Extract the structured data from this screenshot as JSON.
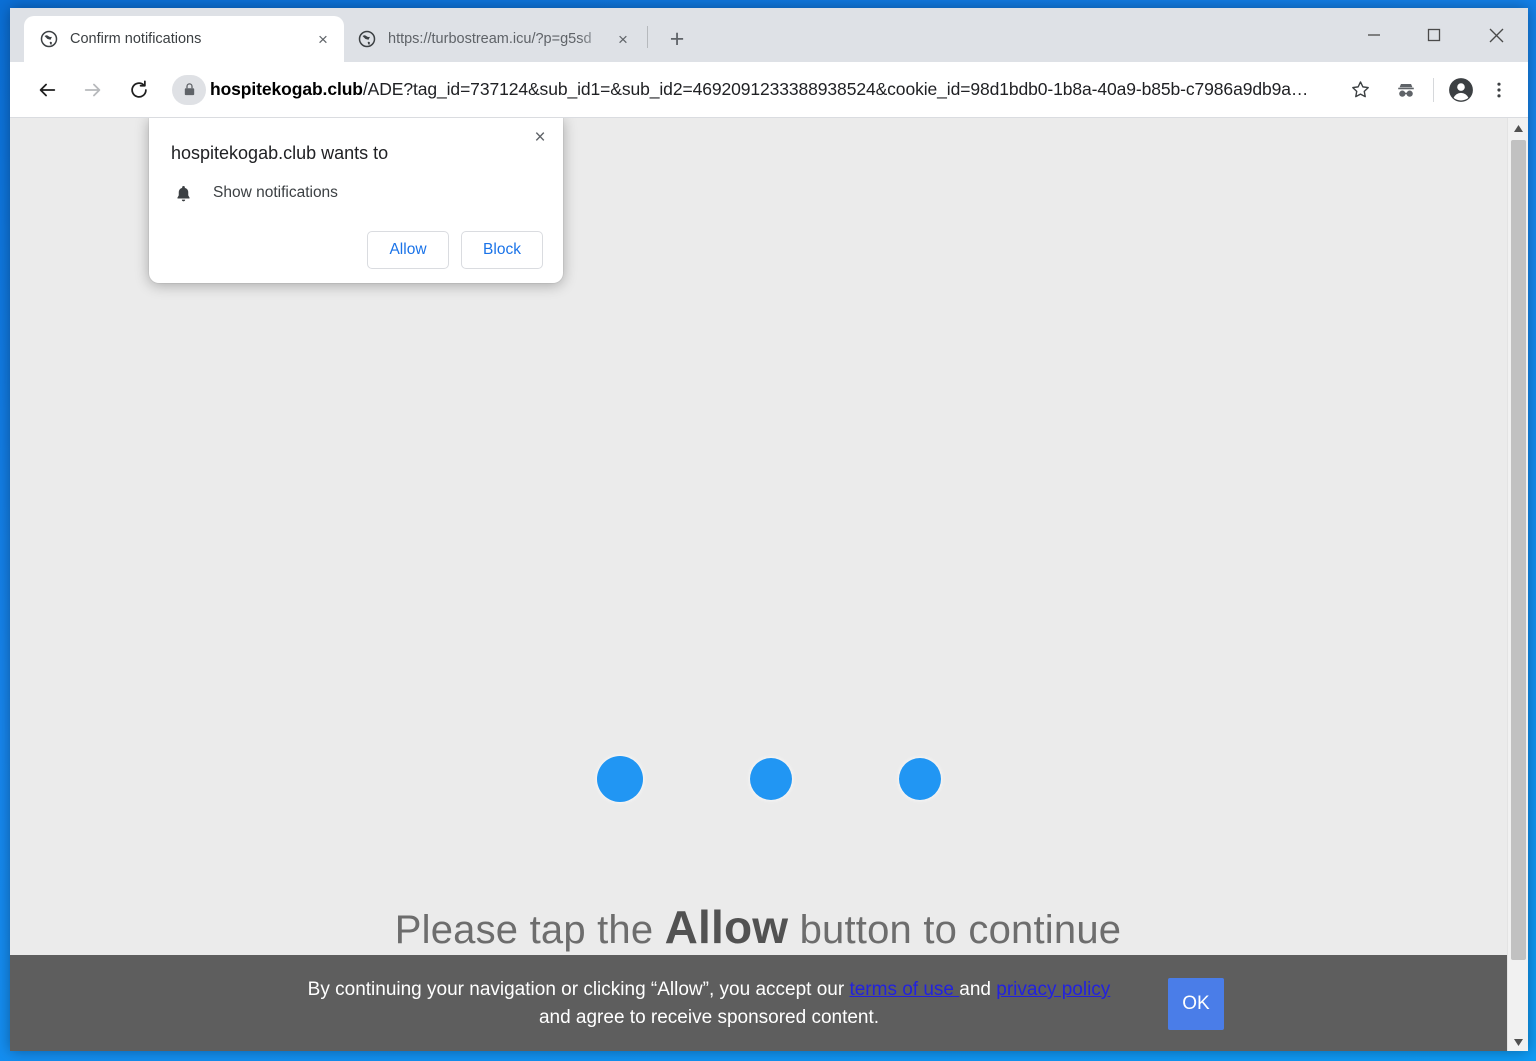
{
  "window": {
    "controls": [
      {
        "name": "minimize",
        "glyph": "minimize-icon"
      },
      {
        "name": "maximize",
        "glyph": "maximize-icon"
      },
      {
        "name": "close",
        "glyph": "close-icon"
      }
    ]
  },
  "tabs": [
    {
      "title": "Confirm notifications",
      "active": true,
      "favicon": "globe-icon",
      "close_label": "×"
    },
    {
      "title": "https://turbostream.icu/?p=g5sd",
      "active": false,
      "favicon": "globe-icon",
      "close_label": "×"
    }
  ],
  "new_tab_label": "+",
  "toolbar": {
    "back_icon": "back-arrow-icon",
    "forward_icon": "forward-arrow-icon",
    "reload_icon": "reload-icon",
    "lock_icon": "lock-icon",
    "url_host": "hospitekogab.club",
    "url_path": "/ADE?tag_id=737124&sub_id1=&sub_id2=4692091233388938524&cookie_id=98d1bdb0-1b8a-40a9-b85b-c7986a9db9a…",
    "url_full": "hospitekogab.club/ADE?tag_id=737124&sub_id1=&sub_id2=4692091233388938524&cookie_id=98d1bdb0-1b8a-40a9-b85b-c7986a9db9a…",
    "bookmark_icon": "star-icon",
    "extension_icon": "incognito-extension-icon",
    "profile_icon": "profile-avatar-icon",
    "menu_icon": "three-dot-menu-icon"
  },
  "permission_dialog": {
    "title": "hospitekogab.club wants to",
    "option_icon": "bell-icon",
    "option_label": "Show notifications",
    "allow_label": "Allow",
    "block_label": "Block",
    "close_label": "×"
  },
  "page": {
    "background_color": "#ebebeb",
    "dots_color": "#2196f3",
    "dots_count": 3,
    "headline_prefix": "Please tap the ",
    "headline_strong": "Allow",
    "headline_suffix": " button to continue"
  },
  "consent_bar": {
    "background_color": "#5e5e5e",
    "text_before": "By continuing your navigation or clicking “Allow”, you accept our ",
    "link_terms": "terms of use ",
    "text_between": "and ",
    "link_privacy": "privacy policy",
    "text_after": " and agree to receive sponsored content.",
    "ok_label": "OK",
    "ok_color": "#4a7de8",
    "link_color": "#2222dd"
  },
  "scrollbar": {
    "up_arrow": "▲",
    "down_arrow": "▼"
  }
}
